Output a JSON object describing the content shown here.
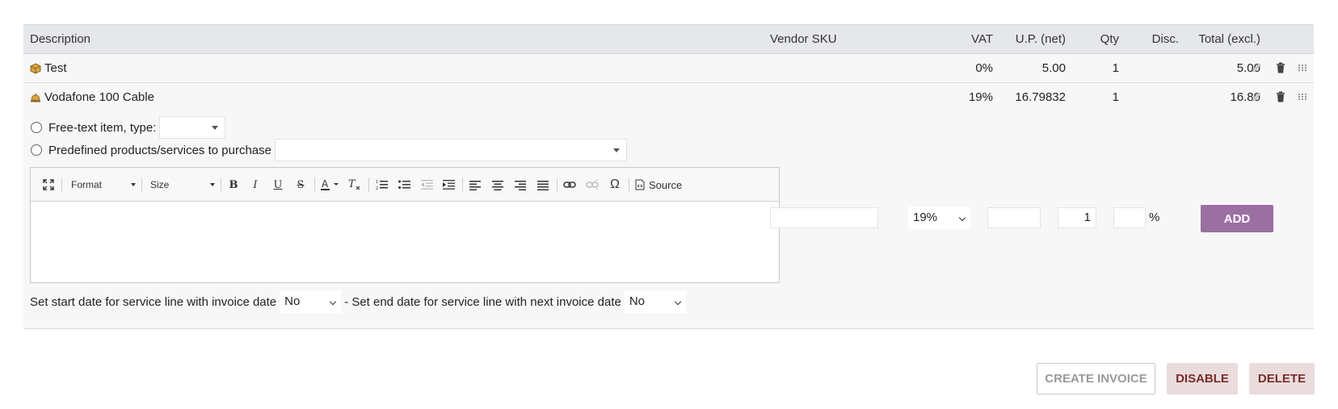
{
  "table": {
    "headers": {
      "description": "Description",
      "vendor_sku": "Vendor SKU",
      "vat": "VAT",
      "unit_price": "U.P. (net)",
      "qty": "Qty",
      "disc": "Disc.",
      "total": "Total (excl.)"
    },
    "rows": [
      {
        "icon": "product-box-icon",
        "description": "Test",
        "vat": "0%",
        "unit_price": "5.00",
        "qty": "1",
        "total": "5.00"
      },
      {
        "icon": "service-bell-icon",
        "description": "Vodafone 100 Cable",
        "vat": "19%",
        "unit_price": "16.79832",
        "qty": "1",
        "total": "16.80"
      }
    ]
  },
  "form": {
    "free_text_label": "Free-text item, type:",
    "predefined_label": "Predefined products/services to purchase",
    "editor": {
      "format_label": "Format",
      "size_label": "Size",
      "source_label": "Source"
    },
    "vat_value": "19%",
    "qty_value": "1",
    "disc_suffix": "%",
    "add_label": "ADD",
    "start_date_label": "Set start date for service line with invoice date",
    "start_date_value": "No",
    "end_date_label": "- Set end date for service line with next invoice date",
    "end_date_value": "No"
  },
  "actions": {
    "create_invoice": "CREATE INVOICE",
    "disable": "DISABLE",
    "delete": "DELETE"
  },
  "colors": {
    "accent": "#9c6fa3",
    "danger_bg": "#eadcdc",
    "danger_text": "#7a2b2b"
  }
}
